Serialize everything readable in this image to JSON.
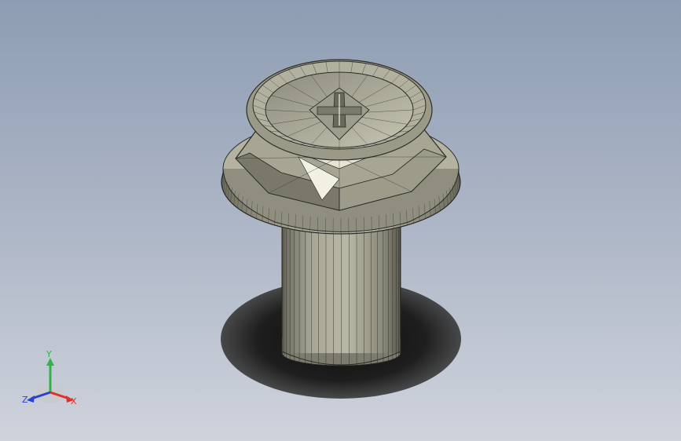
{
  "viewport": {
    "model": "flange-hex-head-bolt",
    "render_style": "shaded-with-edges",
    "colors": {
      "background_top": "#8e9db3",
      "background_bottom": "#cfd3dc",
      "part_light": "#d9d8c8",
      "part_mid": "#a3a291",
      "part_dark": "#5f5e52",
      "edge": "#2b2b26",
      "shadow": "#1c1c1c"
    }
  },
  "triad": {
    "labels": {
      "x": "X",
      "y": "Y",
      "z": "Z"
    },
    "colors": {
      "x": "#e0302a",
      "y": "#2fb34a",
      "z": "#2a3fd9"
    }
  }
}
